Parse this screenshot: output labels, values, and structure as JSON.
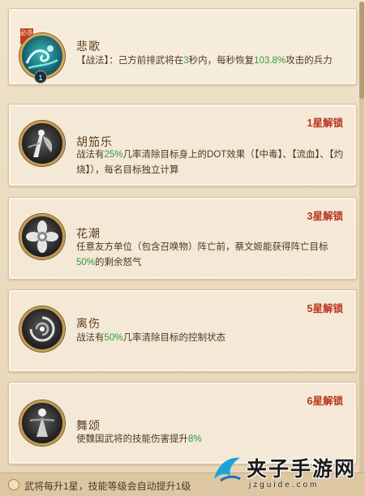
{
  "skills": [
    {
      "title": "悲歌",
      "tag": "必杀",
      "level_badge": "1",
      "unlock": "",
      "desc_parts": [
        "【战法】：己方前排武将在",
        "3",
        "秒内，每秒恢复",
        "103.8%",
        "攻击的兵力"
      ],
      "icon": "wave-icon"
    },
    {
      "title": "胡笳乐",
      "unlock": "1星解锁",
      "desc_parts": [
        "战法有",
        "25%",
        "几率清除目标身上的DOT效果（【中毒】、【流血】、【灼烧】），每名目标独立计算"
      ],
      "icon": "sword-figure-icon"
    },
    {
      "title": "花潮",
      "unlock": "3星解锁",
      "desc_parts": [
        "任意友方单位（包含召唤物）阵亡前，蔡文姬能获得阵亡目标",
        "50%",
        "的剩余怒气"
      ],
      "icon": "flower-icon"
    },
    {
      "title": "离伤",
      "unlock": "5星解锁",
      "desc_parts": [
        "战法有",
        "50%",
        "几率清除目标的控制状态"
      ],
      "icon": "swirl-icon"
    },
    {
      "title": "舞颂",
      "unlock": "6星解锁",
      "desc_parts": [
        "使魏国武将的技能伤害提升",
        "8%"
      ],
      "icon": "dancer-icon"
    }
  ],
  "footer": {
    "text": "武将每升1星，技能等级会自动提升1级"
  },
  "watermark": {
    "name": "夹子手游网",
    "url": "jzguide.com"
  },
  "colors": {
    "unlock": "#b8341f",
    "highlight": "#2f9a3a",
    "text": "#4b3a28",
    "title": "#5a3f22"
  }
}
